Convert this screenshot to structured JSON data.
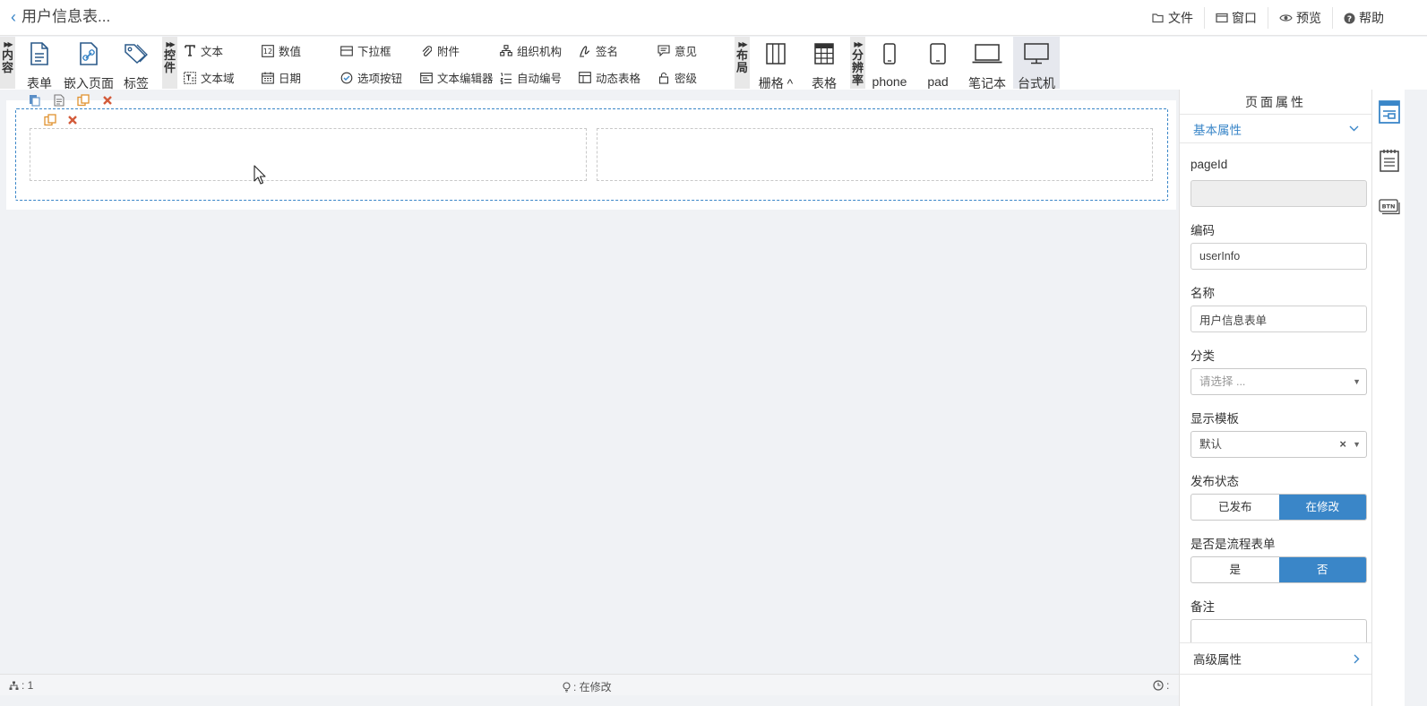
{
  "header": {
    "title": "用户信息表...",
    "menu": [
      {
        "label": "文件",
        "icon": "folder-icon"
      },
      {
        "label": "窗口",
        "icon": "window-icon"
      },
      {
        "label": "预览",
        "icon": "eye-icon"
      },
      {
        "label": "帮助",
        "icon": "help-icon"
      }
    ]
  },
  "toolbar": {
    "groups": {
      "content": "内\n容",
      "controls": "控\n件",
      "layout": "布\n局",
      "resolution": "分\n辨\n率"
    },
    "content_items": [
      "表单",
      "嵌入页面",
      "标签"
    ],
    "controls_row1": [
      "文本",
      "数值",
      "下拉框",
      "附件",
      "组织机构",
      "签名",
      "意见"
    ],
    "controls_row2": [
      "文本域",
      "日期",
      "选项按钮",
      "文本编辑器",
      "自动编号",
      "动态表格",
      "密级"
    ],
    "layout_items": [
      "栅格 ^",
      "表格"
    ],
    "resolution_items": [
      "phone",
      "pad",
      "笔记本",
      "台式机"
    ]
  },
  "statusbar": {
    "count": ": 1",
    "state": ": 在修改",
    "right": ":"
  },
  "props": {
    "title": "页面属性",
    "basic_section": "基本属性",
    "pageid_label": "pageId",
    "pageid_value": "",
    "code_label": "编码",
    "code_value": "userInfo",
    "name_label": "名称",
    "name_value": "用户信息表单",
    "category_label": "分类",
    "category_placeholder": "请选择 ...",
    "template_label": "显示模板",
    "template_value": "默认",
    "publish_label": "发布状态",
    "publish_options": [
      "已发布",
      "在修改"
    ],
    "publish_selected": "在修改",
    "workflow_label": "是否是流程表单",
    "workflow_options": [
      "是",
      "否"
    ],
    "workflow_selected": "否",
    "remark_label": "备注",
    "advanced_section": "高级属性"
  },
  "colors": {
    "accent": "#3a86c8",
    "action_orange": "#e0922f",
    "delete_red": "#d35b3a"
  }
}
